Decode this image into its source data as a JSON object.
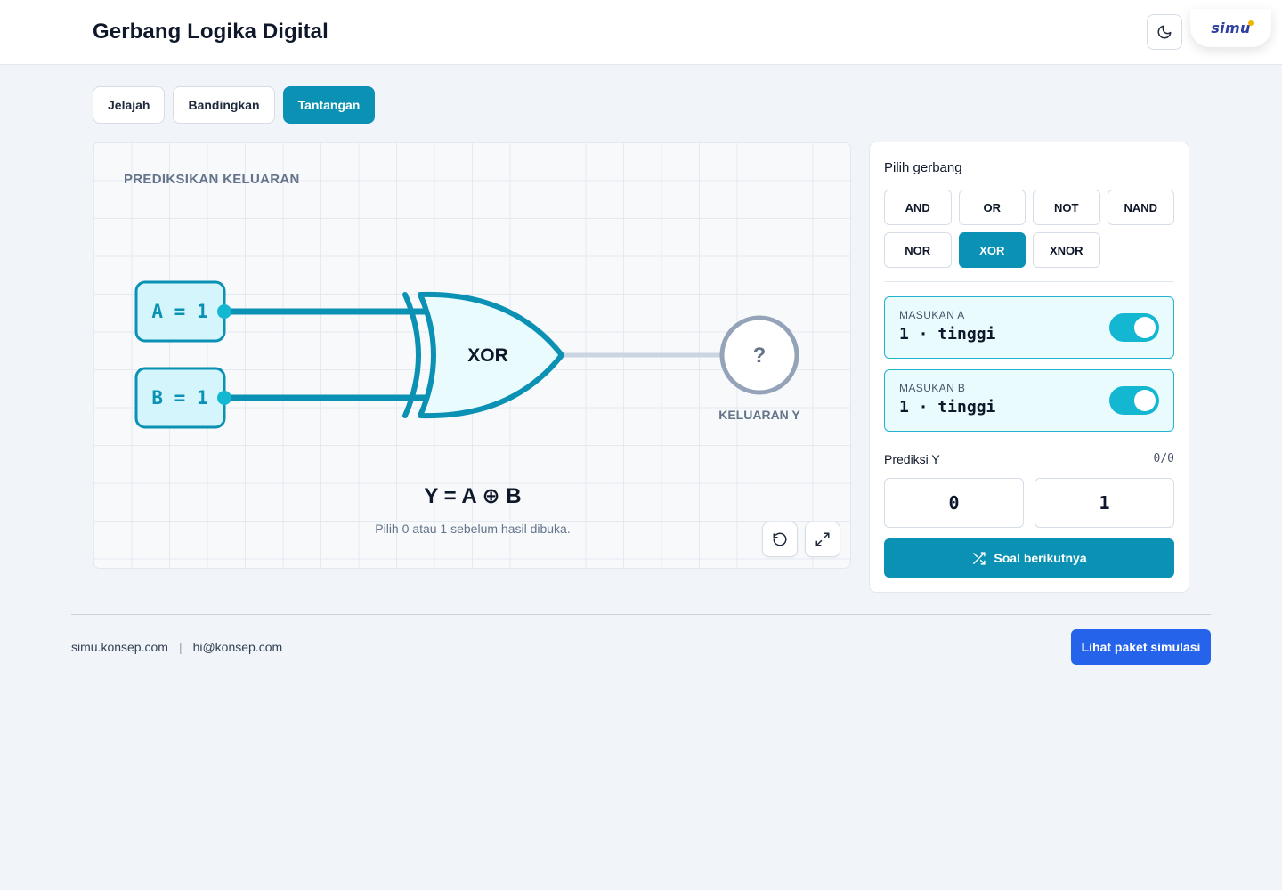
{
  "header": {
    "title": "Gerbang Logika Digital",
    "theme_toggle_icon": "moon-icon",
    "logo_text": "simu"
  },
  "tabs": [
    {
      "label": "Jelajah",
      "active": false
    },
    {
      "label": "Bandingkan",
      "active": false
    },
    {
      "label": "Tantangan",
      "active": true
    }
  ],
  "canvas": {
    "heading": "PREDIKSIKAN KELUARAN",
    "input_a_label": "A = 1",
    "input_b_label": "B = 1",
    "gate_label": "XOR",
    "output_symbol": "?",
    "output_label": "KELUARAN Y",
    "formula": "Y = A ⊕ B",
    "hint": "Pilih 0 atau 1 sebelum hasil dibuka.",
    "reset_icon": "reset-icon",
    "fullscreen_icon": "expand-icon"
  },
  "panel": {
    "title": "Pilih gerbang",
    "gates": [
      "AND",
      "OR",
      "NOT",
      "NAND",
      "NOR",
      "XOR",
      "XNOR"
    ],
    "selected_gate": "XOR",
    "input_a": {
      "label": "MASUKAN A",
      "value": "1 · tinggi",
      "on": true
    },
    "input_b": {
      "label": "MASUKAN B",
      "value": "1 · tinggi",
      "on": true
    },
    "predict_label": "Prediksi Y",
    "predict_score": "0/0",
    "choices": [
      "0",
      "1"
    ],
    "next_label": "Soal berikutnya",
    "next_icon": "shuffle-icon"
  },
  "footer": {
    "site": "simu.konsep.com",
    "separator": "|",
    "email": "hi@konsep.com",
    "cta": "Lihat paket simulasi"
  },
  "colors": {
    "accent": "#0a91b3",
    "toggle_on": "#14b7d2",
    "cta": "#2563eb",
    "input_fill": "#e9fbfd"
  }
}
